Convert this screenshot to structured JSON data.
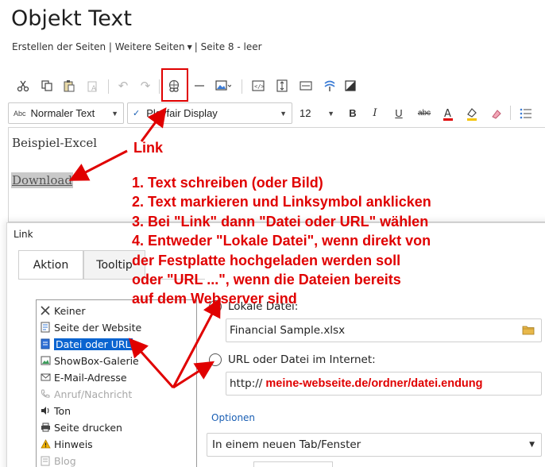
{
  "page": {
    "title": "Objekt Text"
  },
  "breadcrumb": {
    "part1": "Erstellen der Seiten | Weitere Seiten",
    "part2": "| Seite 8 - leer"
  },
  "toolbar2": {
    "style": "Normaler Text",
    "style_prefix": "Abc",
    "font": "Playfair Display",
    "font_check": "✓",
    "size": "12"
  },
  "editor": {
    "line1": "Beispiel-Excel",
    "link_text": "Download"
  },
  "annotations": {
    "link": "Link",
    "steps": [
      "1. Text schreiben (oder Bild)",
      "2. Text markieren und Linksymbol anklicken",
      "3. Bei \"Link\" dann \"Datei oder URL\" wählen",
      "4. Entweder \"Lokale Datei\", wenn direkt von",
      "der Festplatte hochgeladen werden soll",
      "oder \"URL ...\", wenn die Dateien bereits",
      "auf dem Webserver sind"
    ]
  },
  "dialog": {
    "title": "Link",
    "tabs": [
      "Aktion",
      "Tooltip"
    ],
    "list": [
      {
        "label": "Keiner",
        "icon": "x-icon"
      },
      {
        "label": "Seite der Website",
        "icon": "page-icon"
      },
      {
        "label": "Datei oder URL",
        "icon": "file-icon"
      },
      {
        "label": "ShowBox-Galerie",
        "icon": "gallery-icon"
      },
      {
        "label": "E-Mail-Adresse",
        "icon": "mail-icon"
      },
      {
        "label": "Anruf/Nachricht",
        "icon": "phone-icon"
      },
      {
        "label": "Ton",
        "icon": "speaker-icon"
      },
      {
        "label": "Seite drucken",
        "icon": "printer-icon"
      },
      {
        "label": "Hinweis",
        "icon": "warning-icon"
      },
      {
        "label": "Blog",
        "icon": "blog-icon"
      }
    ],
    "local_label": "Lokale Datei:",
    "local_value": "Financial Sample.xlsx",
    "url_label": "URL oder Datei im Internet:",
    "url_prefix": "http://",
    "url_hint": "meine-webseite.de/ordner/datei.endung",
    "options_label": "Optionen",
    "target": "In einem neuen Tab/Fenster"
  },
  "colors": {
    "annotation": "#e00000",
    "selection": "#0a64d0",
    "options": "#1a5fb4"
  }
}
